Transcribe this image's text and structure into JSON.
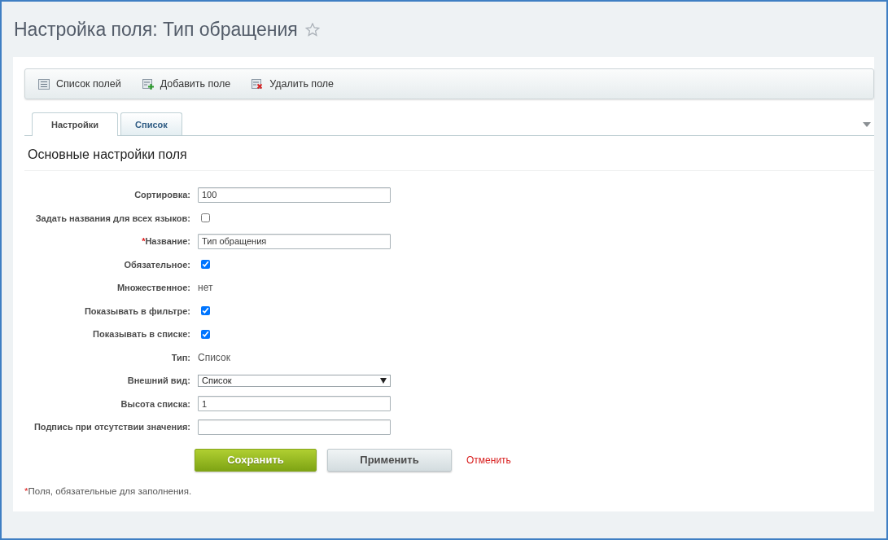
{
  "title": "Настройка поля: Тип обращения",
  "toolbar": [
    {
      "kind": "list",
      "label": "Список полей"
    },
    {
      "kind": "add",
      "label": "Добавить поле"
    },
    {
      "kind": "delete",
      "label": "Удалить поле"
    }
  ],
  "tabs": [
    {
      "label": "Настройки",
      "selected": true
    },
    {
      "label": "Список",
      "selected": false
    }
  ],
  "section_title": "Основные настройки поля",
  "fields": [
    {
      "kind": "text",
      "label": "Сортировка:",
      "value": "100"
    },
    {
      "kind": "checkbox",
      "label": "Задать названия для всех языков:",
      "checked": false
    },
    {
      "kind": "text",
      "required_mark": "*",
      "label": "Название:",
      "value": "Тип обращения"
    },
    {
      "kind": "checkbox",
      "label": "Обязательное:",
      "checked": true
    },
    {
      "kind": "static",
      "label": "Множественное:",
      "value": "нет"
    },
    {
      "kind": "checkbox",
      "label": "Показывать в фильтре:",
      "checked": true
    },
    {
      "kind": "checkbox",
      "label": "Показывать в списке:",
      "checked": true
    },
    {
      "kind": "static",
      "label": "Тип:",
      "value": "Список"
    },
    {
      "kind": "select",
      "label": "Внешний вид:",
      "value": "Список"
    },
    {
      "kind": "text",
      "label": "Высота списка:",
      "value": "1"
    },
    {
      "kind": "text",
      "label": "Подпись при отсутствии значения:"
    }
  ],
  "buttons": [
    {
      "kind": "primary",
      "label": "Сохранить"
    },
    {
      "kind": "secondary",
      "label": "Применить"
    },
    {
      "kind": "link",
      "label": "Отменить"
    }
  ],
  "footnote": {
    "mark": "*",
    "text": "Поля, обязательные для заполнения."
  }
}
